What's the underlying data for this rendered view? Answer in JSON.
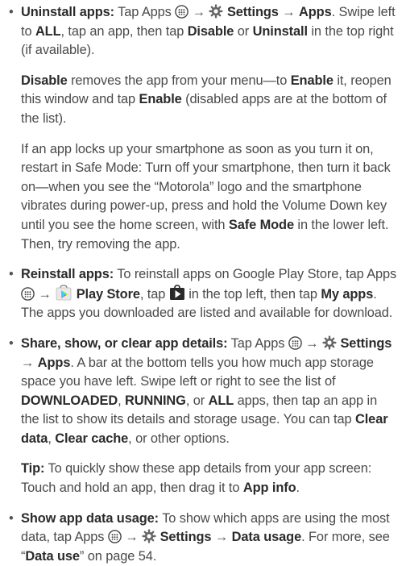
{
  "bullet": "•",
  "arrow": "→",
  "uninstall": {
    "label": "Uninstall apps:",
    "t1": " Tap Apps ",
    "settings": "Settings",
    "apps": "Apps",
    "t2": ". Swipe left to ",
    "all": "ALL",
    "t3": ", tap an app, then tap ",
    "disable": "Disable",
    "t4": " or ",
    "uninstall": "Uninstall",
    "t5": " in the top right (if available)."
  },
  "disable_para": {
    "disable": "Disable",
    "t1": " removes the app from your menu—to ",
    "enable": "Enable",
    "t2": " it, reopen this window and tap ",
    "enable2": "Enable",
    "t3": " (disabled apps are at the bottom of the list)."
  },
  "safemode_para": {
    "t1": "If an app locks up your smartphone as soon as you turn it on, restart in Safe Mode: Turn off your smartphone, then turn it back on—when you see the “Motorola” logo and the smartphone vibrates during power-up, press and hold the Volume Down key until you see the home screen, with ",
    "safe_mode": "Safe Mode",
    "t2": " in the lower left. Then, try removing the app."
  },
  "reinstall": {
    "label": "Reinstall apps:",
    "t1": " To reinstall apps on Google Play Store, tap Apps ",
    "play_store": "Play Store",
    "t2": ", tap ",
    "t3": " in the top left, then tap ",
    "my_apps": "My apps",
    "t4": ". The apps you downloaded are listed and available for download."
  },
  "share": {
    "label": "Share, show, or clear app details:",
    "t1": " Tap Apps ",
    "settings": "Settings",
    "apps": "Apps",
    "t2": ". A bar at the bottom tells you how much app storage space you have left. Swipe left or right to see the list of ",
    "downloaded": "DOWNLOADED",
    "c1": ", ",
    "running": "RUNNING",
    "t3": ", or ",
    "all": "ALL",
    "t4": " apps, then tap an app in the list to show its details and storage usage. You can tap ",
    "clear_data": "Clear data",
    "c2": ", ",
    "clear_cache": "Clear cache",
    "t5": ", or other options."
  },
  "tip": {
    "label": "Tip:",
    "t1": " To quickly show these app details from your app screen: Touch and hold an app, then drag it to ",
    "app_info": "App info",
    "t2": "."
  },
  "data_usage": {
    "label": "Show app data usage:",
    "t1": " To show which apps are using the most data, tap Apps ",
    "settings": "Settings",
    "data_usage": "Data usage",
    "t2": ". For more, see “",
    "data_use": "Data use",
    "t3": "” on page 54."
  },
  "icons": [
    "apps-icon",
    "settings-icon",
    "play-store-icon",
    "play-menu-icon"
  ]
}
